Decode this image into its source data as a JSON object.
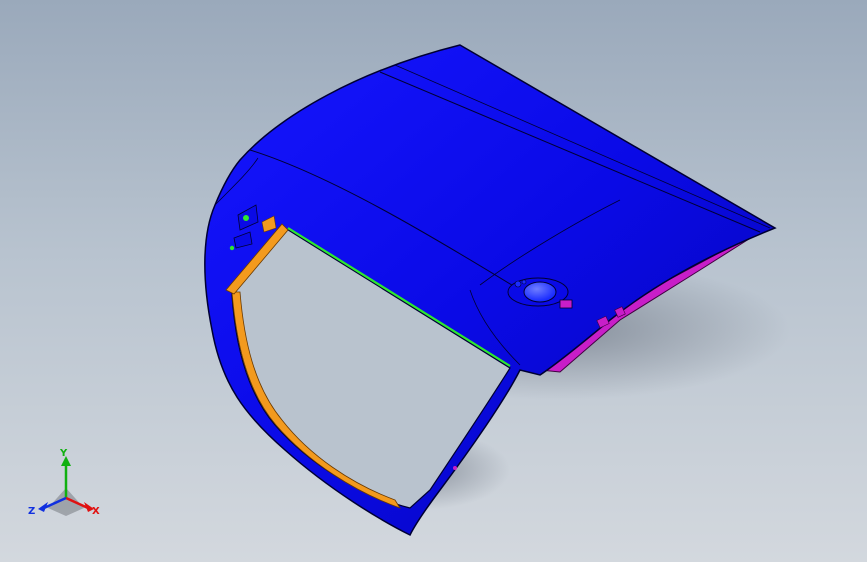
{
  "viewport": {
    "background_top": "#9aa9bb",
    "background_bottom": "#d3d8de"
  },
  "model": {
    "body_color": "#0a0ae6",
    "body_edge_color": "#000033",
    "seal_color": "#f39a1e",
    "glass_edge_color": "#2ee82e",
    "inner_panel_color": "#c81ec8",
    "handle_color": "#1a2cff"
  },
  "triad": {
    "x_label": "X",
    "y_label": "Y",
    "z_label": "Z",
    "x_color": "#e01010",
    "y_color": "#10b010",
    "z_color": "#1030e0"
  }
}
